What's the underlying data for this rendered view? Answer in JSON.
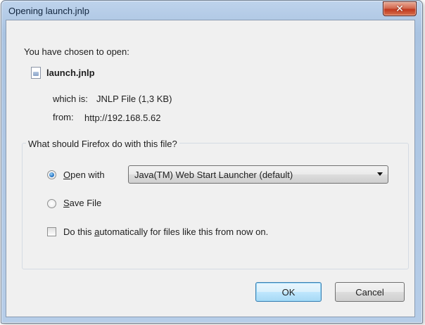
{
  "window": {
    "title": "Opening launch.jnlp",
    "close_glyph": "✕"
  },
  "dialog": {
    "intro": "You have chosen to open:",
    "file_name": "launch.jnlp",
    "which_is_label": "which is:",
    "which_is_value": "JNLP File (1,3 KB)",
    "from_label": "from:",
    "from_value": "http://192.168.5.62",
    "group_label": "What should Firefox do with this file?",
    "open_with": {
      "label_mnemonic": "O",
      "label_rest": "pen with",
      "checked": true,
      "selected_app": "Java(TM) Web Start Launcher (default)"
    },
    "save_file": {
      "label_mnemonic": "S",
      "label_rest": "ave File",
      "checked": false
    },
    "auto": {
      "label_before": "Do this ",
      "label_mnemonic": "a",
      "label_after": "utomatically for files like this from now on.",
      "checked": false
    },
    "ok_label": "OK",
    "cancel_label": "Cancel"
  },
  "icons": {
    "file": "document-icon",
    "close": "close-icon",
    "dropdown": "chevron-down-icon"
  }
}
